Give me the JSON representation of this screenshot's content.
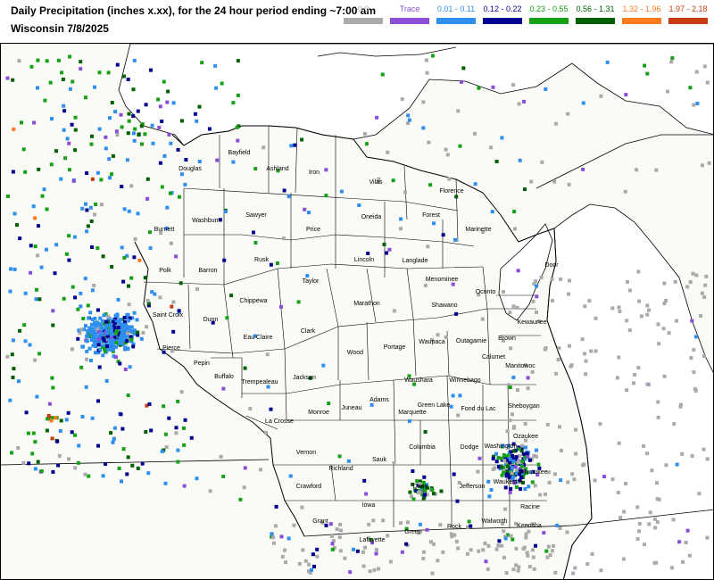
{
  "header": {
    "title_line1": "Daily Precipitation (inches  x.xx),  for the 24 hour period ending ~7:00 am",
    "title_line2": "Wisconsin 7/8/2025"
  },
  "legend": [
    {
      "label": "0.0",
      "color": "#aaaaaa",
      "text_color": "#aaaaaa"
    },
    {
      "label": "Trace",
      "color": "#8a4ed6",
      "text_color": "#8a4ed6"
    },
    {
      "label": "0.01 - 0.11",
      "color": "#2f8fef",
      "text_color": "#2f8fef"
    },
    {
      "label": "0.12 - 0.22",
      "color": "#000090",
      "text_color": "#000090"
    },
    {
      "label": "0.23 - 0.55",
      "color": "#16a016",
      "text_color": "#16a016"
    },
    {
      "label": "0.56 - 1.31",
      "color": "#006000",
      "text_color": "#006000"
    },
    {
      "label": "1.32 - 1.96",
      "color": "#ff7a1a",
      "text_color": "#ff7a1a"
    },
    {
      "label": "1.97 - 2.18",
      "color": "#c83a10",
      "text_color": "#c83a10"
    }
  ],
  "counties": [
    "Douglas",
    "Bayfield",
    "Ashland",
    "Iron",
    "Vilas",
    "Florence",
    "Burnett",
    "Washburn",
    "Sawyer",
    "Price",
    "Oneida",
    "Forest",
    "Marinette",
    "Polk",
    "Barron",
    "Rusk",
    "Lincoln",
    "Langlade",
    "Menominee",
    "Oconto",
    "Door",
    "Taylor",
    "Saint Croix",
    "Dunn",
    "Chippewa",
    "Marathon",
    "Shawano",
    "Kewaunee",
    "Eau Claire",
    "Clark",
    "Wood",
    "Portage",
    "Waupaca",
    "Outagamie",
    "Brown",
    "Pierce",
    "Pepin",
    "Calumet",
    "Manitowoc",
    "Buffalo",
    "Trempealeau",
    "Jackson",
    "Waushara",
    "Winnebago",
    "Adams",
    "Juneau",
    "Monroe",
    "La Crosse",
    "Marquette",
    "Green Lake",
    "Fond du Lac",
    "Sheboygan",
    "Vernon",
    "Columbia",
    "Dodge",
    "Washington",
    "Ozaukee",
    "Sauk",
    "Richland",
    "Crawford",
    "Waukesha",
    "Milwaukee",
    "Dane",
    "Jefferson",
    "Iowa",
    "Grant",
    "Racine",
    "Lafayette",
    "Green",
    "Rock",
    "Walworth",
    "Kenosha"
  ]
}
